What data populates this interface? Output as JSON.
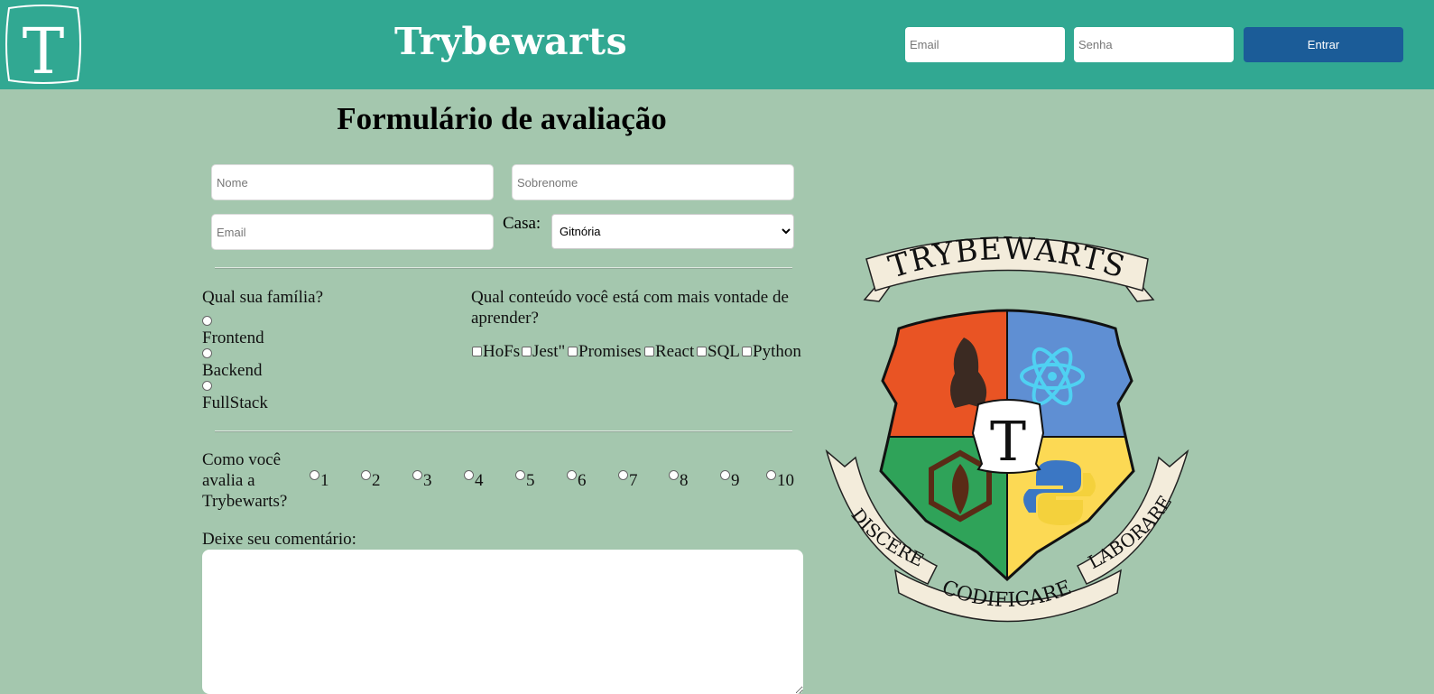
{
  "header": {
    "logo_letter": "T",
    "brand": "Trybewarts",
    "login": {
      "email_placeholder": "Email",
      "password_placeholder": "Senha",
      "submit_label": "Entrar"
    }
  },
  "form": {
    "title": "Formulário de avaliação",
    "name_placeholder": "Nome",
    "lastname_placeholder": "Sobrenome",
    "email_placeholder": "Email",
    "house_label": "Casa:",
    "house_selected": "Gitnória",
    "family": {
      "question": "Qual sua família?",
      "options": [
        "Frontend",
        "Backend",
        "FullStack"
      ]
    },
    "content": {
      "question": "Qual conteúdo você está com mais vontade de aprender?",
      "options": [
        "HoFs",
        "Jest\"",
        "Promises",
        "React",
        "SQL",
        "Python"
      ]
    },
    "rating": {
      "question": "Como você avalia a Trybewarts?",
      "options": [
        "1",
        "2",
        "3",
        "4",
        "5",
        "6",
        "7",
        "8",
        "9",
        "10"
      ]
    },
    "comment_label": "Deixe seu comentário:"
  },
  "crest": {
    "banner_top": "TRYBEWARTS",
    "center_letter": "T",
    "motto": [
      "DISCERE",
      "CODIFICARE",
      "LABORARE"
    ],
    "colors": {
      "orange": "#e95424",
      "blue": "#5f8fd3",
      "green": "#2fa359",
      "yellow": "#fcd954",
      "ribbon": "#f3ecdb"
    }
  },
  "colors": {
    "header_bg": "#31a892",
    "page_bg": "#a4c7ae",
    "button_bg": "#1b5c98"
  }
}
